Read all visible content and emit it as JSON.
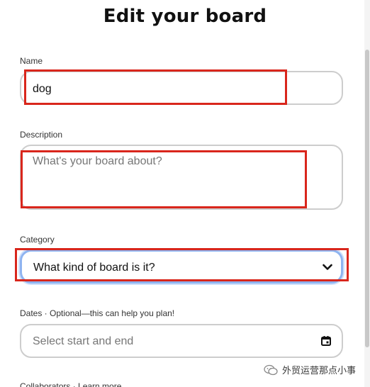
{
  "header": {
    "title": "Edit your board"
  },
  "form": {
    "name": {
      "label": "Name",
      "value": "dog"
    },
    "description": {
      "label": "Description",
      "placeholder": "What's your board about?"
    },
    "category": {
      "label": "Category",
      "placeholder": "What kind of board is it?"
    },
    "dates": {
      "label": "Dates · Optional—this can help you plan!",
      "placeholder": "Select start and end"
    },
    "collaborators": {
      "label": "Collaborators · Learn more"
    }
  },
  "watermark": {
    "text": "外贸运营那点小事"
  },
  "icons": {
    "category_dropdown": "chevron-down-icon",
    "dates_picker": "calendar-icon",
    "watermark": "wechat-icon"
  },
  "colors": {
    "annotation": "#d9261c",
    "field_border": "#cdcdcd",
    "focus_border": "#8fb4f0"
  }
}
